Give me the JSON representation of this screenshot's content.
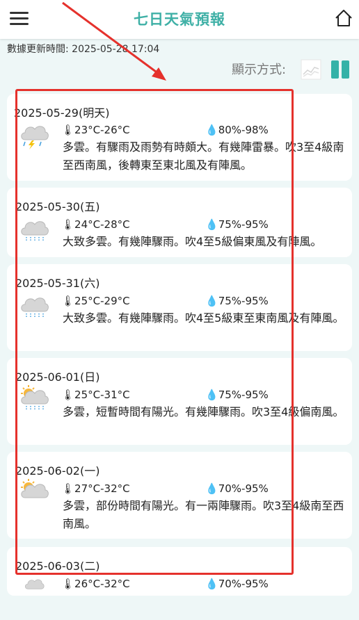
{
  "header": {
    "title": "七日天氣預報"
  },
  "update_text": "數據更新時間: 2025-05-28 17:04",
  "display_label": "顯示方式:",
  "forecasts": [
    {
      "date": "2025-05-29(明天)",
      "temp": "23°C-26°C",
      "humidity": "80%-98%",
      "icon": "thunderstorm-icon",
      "desc": "多雲。有驟雨及雨勢有時頗大。有幾陣雷暴。吹3至4級南至西南風，後轉東至東北風及有陣風。"
    },
    {
      "date": "2025-05-30(五)",
      "temp": "24°C-28°C",
      "humidity": "75%-95%",
      "icon": "rain-cloud-icon",
      "desc": "大致多雲。有幾陣驟雨。吹4至5級偏東風及有陣風。"
    },
    {
      "date": "2025-05-31(六)",
      "temp": "25°C-29°C",
      "humidity": "75%-95%",
      "icon": "rain-cloud-icon",
      "desc": "大致多雲。有幾陣驟雨。吹4至5級東至東南風及有陣風。"
    },
    {
      "date": "2025-06-01(日)",
      "temp": "25°C-31°C",
      "humidity": "75%-95%",
      "icon": "sun-cloud-rain-icon",
      "desc": "多雲，短暫時間有陽光。有幾陣驟雨。吹3至4級偏南風。"
    },
    {
      "date": "2025-06-02(一)",
      "temp": "27°C-32°C",
      "humidity": "70%-95%",
      "icon": "sun-cloud-icon",
      "desc": "多雲，部份時間有陽光。有一兩陣驟雨。吹3至4級南至西南風。"
    },
    {
      "date": "2025-06-03(二)",
      "temp": "26°C-32°C",
      "humidity": "70%-95%",
      "icon": "thunderstorm-icon",
      "desc": ""
    }
  ],
  "colors": {
    "accent": "#3fb0a6",
    "highlight": "#e5312c",
    "background": "#eef7f7"
  }
}
